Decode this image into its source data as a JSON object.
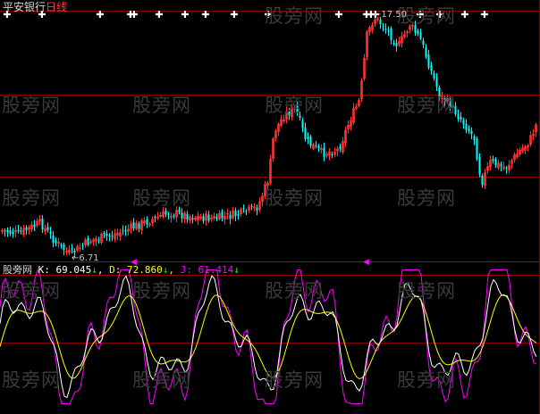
{
  "header": {
    "app": "平安银行",
    "period": "日线"
  },
  "indicator": {
    "name": "股旁网",
    "k_label": "K:",
    "k_value": "69.045",
    "k_arrow": "↓",
    "d_label": "D:",
    "d_value": "72.860",
    "d_arrow": "↓",
    "j_label": "J:",
    "j_value": "61.414",
    "j_arrow": "↓"
  },
  "annotations": {
    "low_price": "6.71",
    "high_price": "17.50"
  },
  "watermark": "股旁网",
  "colors": {
    "background": "#000000",
    "up": "#ff3232",
    "down": "#00ffff",
    "grid": "#8b0000",
    "k_line": "#ffffff",
    "d_line": "#ffff00",
    "j_line": "#ff00ff",
    "signal": "#ffffff"
  }
}
